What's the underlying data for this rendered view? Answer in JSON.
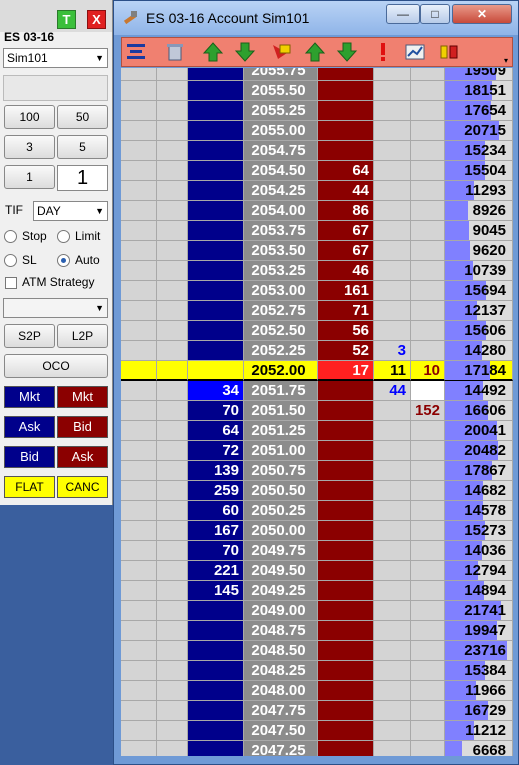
{
  "order_panel": {
    "instrument": "ES 03-16",
    "account": "Sim101",
    "t_button": "T",
    "x_button": "X",
    "qty_presets": [
      "100",
      "50",
      "3",
      "5",
      "1"
    ],
    "quantity": "1",
    "tif_label": "TIF",
    "tif_value": "DAY",
    "stop_label": "Stop",
    "limit_label": "Limit",
    "sl_label": "SL",
    "auto_label": "Auto",
    "atm_label": "ATM Strategy",
    "s2p_label": "S2P",
    "l2p_label": "L2P",
    "oco_label": "OCO",
    "buy_mkt": "Mkt",
    "sell_mkt": "Mkt",
    "buy_ask": "Ask",
    "sell_bid": "Bid",
    "buy_bid": "Bid",
    "sell_ask": "Ask",
    "flat_label": "FLAT",
    "canc_label": "CANC"
  },
  "window": {
    "title": "ES 03-16  Account Sim101",
    "minimize": "—",
    "maximize": "□",
    "close": "✕"
  },
  "ladder": [
    {
      "price": "2055.75",
      "bid": "",
      "ask": "",
      "c6": "",
      "c7": "",
      "vol": "19509",
      "bar": 0.82
    },
    {
      "price": "2055.50",
      "bid": "",
      "ask": "",
      "c6": "",
      "c7": "",
      "vol": "18151",
      "bar": 0.76
    },
    {
      "price": "2055.25",
      "bid": "",
      "ask": "",
      "c6": "",
      "c7": "",
      "vol": "17654",
      "bar": 0.74
    },
    {
      "price": "2055.00",
      "bid": "",
      "ask": "",
      "c6": "",
      "c7": "",
      "vol": "20715",
      "bar": 0.87
    },
    {
      "price": "2054.75",
      "bid": "",
      "ask": "",
      "c6": "",
      "c7": "",
      "vol": "15234",
      "bar": 0.64
    },
    {
      "price": "2054.50",
      "bid": "",
      "ask": "64",
      "c6": "",
      "c7": "",
      "vol": "15504",
      "bar": 0.65
    },
    {
      "price": "2054.25",
      "bid": "",
      "ask": "44",
      "c6": "",
      "c7": "",
      "vol": "11293",
      "bar": 0.47
    },
    {
      "price": "2054.00",
      "bid": "",
      "ask": "86",
      "c6": "",
      "c7": "",
      "vol": "8926",
      "bar": 0.37
    },
    {
      "price": "2053.75",
      "bid": "",
      "ask": "67",
      "c6": "",
      "c7": "",
      "vol": "9045",
      "bar": 0.38
    },
    {
      "price": "2053.50",
      "bid": "",
      "ask": "67",
      "c6": "",
      "c7": "",
      "vol": "9620",
      "bar": 0.4
    },
    {
      "price": "2053.25",
      "bid": "",
      "ask": "46",
      "c6": "",
      "c7": "",
      "vol": "10739",
      "bar": 0.45
    },
    {
      "price": "2053.00",
      "bid": "",
      "ask": "161",
      "c6": "",
      "c7": "",
      "vol": "15694",
      "bar": 0.66
    },
    {
      "price": "2052.75",
      "bid": "",
      "ask": "71",
      "c6": "",
      "c7": "",
      "vol": "12137",
      "bar": 0.51
    },
    {
      "price": "2052.50",
      "bid": "",
      "ask": "56",
      "c6": "",
      "c7": "",
      "vol": "15606",
      "bar": 0.66
    },
    {
      "price": "2052.25",
      "bid": "",
      "ask": "52",
      "c6": "3",
      "c7": "",
      "vol": "14280",
      "bar": 0.6
    },
    {
      "price": "2052.00",
      "bid": "",
      "ask": "17",
      "c6": "11",
      "c7": "10",
      "vol": "17184",
      "bar": 0.72,
      "last": true
    },
    {
      "price": "2051.75",
      "bid": "34",
      "ask": "",
      "c6": "44",
      "c7": "",
      "vol": "14492",
      "bar": 0.61
    },
    {
      "price": "2051.50",
      "bid": "70",
      "ask": "",
      "c6": "",
      "c7": "152",
      "vol": "16606",
      "bar": 0.7
    },
    {
      "price": "2051.25",
      "bid": "64",
      "ask": "",
      "c6": "",
      "c7": "",
      "vol": "20041",
      "bar": 0.84
    },
    {
      "price": "2051.00",
      "bid": "72",
      "ask": "",
      "c6": "",
      "c7": "",
      "vol": "20482",
      "bar": 0.86
    },
    {
      "price": "2050.75",
      "bid": "139",
      "ask": "",
      "c6": "",
      "c7": "",
      "vol": "17867",
      "bar": 0.75
    },
    {
      "price": "2050.50",
      "bid": "259",
      "ask": "",
      "c6": "",
      "c7": "",
      "vol": "14682",
      "bar": 0.62
    },
    {
      "price": "2050.25",
      "bid": "60",
      "ask": "",
      "c6": "",
      "c7": "",
      "vol": "14578",
      "bar": 0.61
    },
    {
      "price": "2050.00",
      "bid": "167",
      "ask": "",
      "c6": "",
      "c7": "",
      "vol": "15273",
      "bar": 0.64
    },
    {
      "price": "2049.75",
      "bid": "70",
      "ask": "",
      "c6": "",
      "c7": "",
      "vol": "14036",
      "bar": 0.59
    },
    {
      "price": "2049.50",
      "bid": "221",
      "ask": "",
      "c6": "",
      "c7": "",
      "vol": "12794",
      "bar": 0.54
    },
    {
      "price": "2049.25",
      "bid": "145",
      "ask": "",
      "c6": "",
      "c7": "",
      "vol": "14894",
      "bar": 0.63
    },
    {
      "price": "2049.00",
      "bid": "",
      "ask": "",
      "c6": "",
      "c7": "",
      "vol": "21741",
      "bar": 0.91
    },
    {
      "price": "2048.75",
      "bid": "",
      "ask": "",
      "c6": "",
      "c7": "",
      "vol": "19947",
      "bar": 0.84
    },
    {
      "price": "2048.50",
      "bid": "",
      "ask": "",
      "c6": "",
      "c7": "",
      "vol": "23716",
      "bar": 1.0
    },
    {
      "price": "2048.25",
      "bid": "",
      "ask": "",
      "c6": "",
      "c7": "",
      "vol": "15384",
      "bar": 0.65
    },
    {
      "price": "2048.00",
      "bid": "",
      "ask": "",
      "c6": "",
      "c7": "",
      "vol": "11966",
      "bar": 0.5
    },
    {
      "price": "2047.75",
      "bid": "",
      "ask": "",
      "c6": "",
      "c7": "",
      "vol": "16729",
      "bar": 0.7
    },
    {
      "price": "2047.50",
      "bid": "",
      "ask": "",
      "c6": "",
      "c7": "",
      "vol": "11212",
      "bar": 0.47
    },
    {
      "price": "2047.25",
      "bid": "",
      "ask": "",
      "c6": "",
      "c7": "",
      "vol": "6668",
      "bar": 0.28
    }
  ],
  "colors": {
    "bid_column": "#00008b",
    "ask_column": "#8b0000",
    "last_price_row": "#ffff00",
    "volume_bar": "#8080ff",
    "toolbar": "#f08070"
  }
}
